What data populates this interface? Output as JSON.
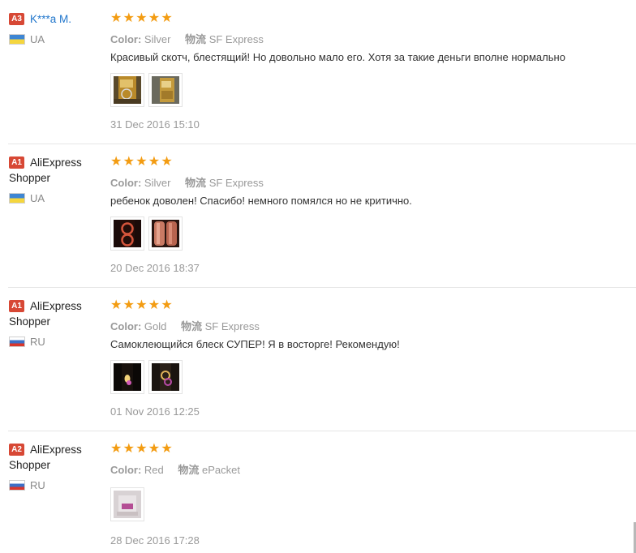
{
  "labels": {
    "color_key": "Color:",
    "logistics_key": "物流"
  },
  "reviews": [
    {
      "badge": "A3",
      "badge_color": "#d74835",
      "user": "K***a M.",
      "country": "UA",
      "rating": 5,
      "color": "Silver",
      "logistics": "SF Express",
      "text": "Красивый скотч, блестящий! Но довольно мало его. Хотя за такие деньги вполне нормально",
      "date": "31 Dec 2016 15:10"
    },
    {
      "badge": "A1",
      "badge_color": "#d74835",
      "user": "AliExpress Shopper",
      "country": "UA",
      "rating": 5,
      "color": "Silver",
      "logistics": "SF Express",
      "text": "ребенок доволен! Спасибо! немного помялся но не критично.",
      "date": "20 Dec 2016 18:37"
    },
    {
      "badge": "A1",
      "badge_color": "#d74835",
      "user": "AliExpress Shopper",
      "country": "RU",
      "rating": 5,
      "color": "Gold",
      "logistics": "SF Express",
      "text": "Самоклеющийся блеск СУПЕР! Я в восторге! Рекомендую!",
      "date": "01 Nov 2016 12:25"
    },
    {
      "badge": "A2",
      "badge_color": "#d74835",
      "user": "AliExpress Shopper",
      "country": "RU",
      "rating": 5,
      "color": "Red",
      "logistics": "ePacket",
      "text": "",
      "date": "28 Dec 2016 17:28"
    }
  ],
  "colors": {
    "star": "#f39c12",
    "badge": "#d74835",
    "masked_name": "#2277cc",
    "muted": "#999999"
  }
}
